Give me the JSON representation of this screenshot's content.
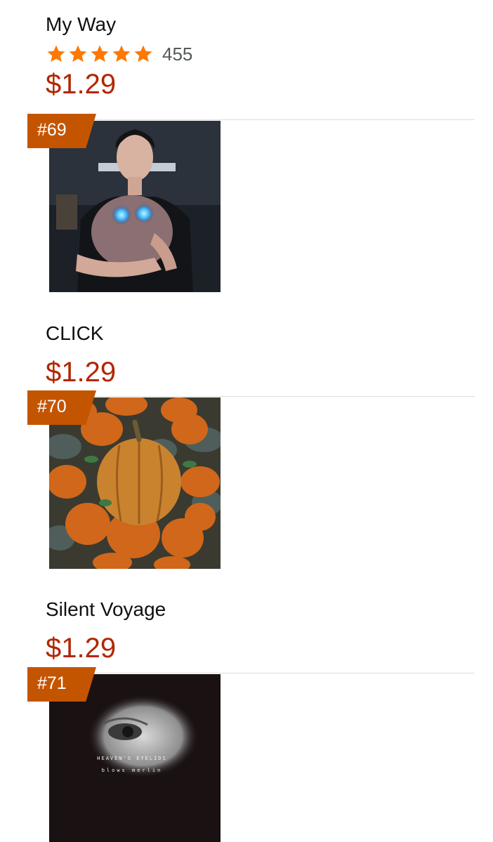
{
  "items": [
    {
      "title": "My Way",
      "rating_count": "455",
      "price": "$1.29",
      "next_rank": "#69"
    },
    {
      "title": "CLICK",
      "price": "$1.29",
      "next_rank": "#70"
    },
    {
      "title": "Silent Voyage",
      "price": "$1.29",
      "next_rank": "#71"
    }
  ],
  "art_text": {
    "line1": "HEAVEN'S EYELIDS",
    "line2": "blows merlin"
  },
  "colors": {
    "price": "#b12704",
    "badge": "#c45500",
    "star": "#ff7800",
    "divider": "#dddddd"
  }
}
